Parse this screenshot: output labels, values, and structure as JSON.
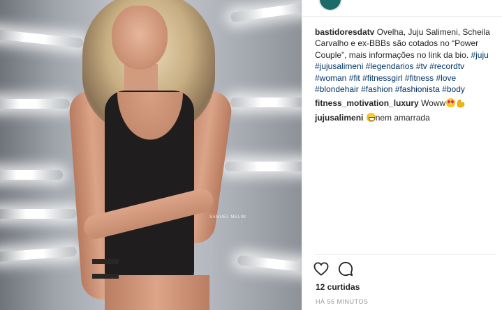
{
  "photo": {
    "watermark": "SAMUEL MELIM"
  },
  "post": {
    "caption": {
      "username": "bastidoresdatv",
      "text": "Ovelha, Juju Salimeni, Scheila Carvalho e ex-BBBs são cotados no “Power Couple”, mais informações no link da bio.",
      "hashtags": [
        "#juju",
        "#jujusalimeni",
        "#legendarios",
        "#tv",
        "#recordtv",
        "#woman",
        "#fit",
        "#fitnessgirl",
        "#fitness",
        "#love",
        "#blondehair",
        "#fashion",
        "#fashionista",
        "#body"
      ]
    },
    "comments": [
      {
        "username": "fitness_motivation_luxury",
        "text": "Woww",
        "emojis": [
          "heart-eyes-emoji",
          "flexed-biceps-emoji"
        ]
      },
      {
        "username": "jujusalimeni",
        "text": "nem amarrada",
        "emoji": "grinning-sweat-emoji"
      }
    ],
    "likes": "12 curtidas",
    "timestamp": "HÁ 56 MINUTOS"
  },
  "icons": {
    "like": "heart-outline-icon",
    "comment": "speech-bubble-icon"
  },
  "colors": {
    "hashtag": "#003569",
    "text": "#262626",
    "muted": "#999999",
    "avatar": "#1c6b68"
  }
}
